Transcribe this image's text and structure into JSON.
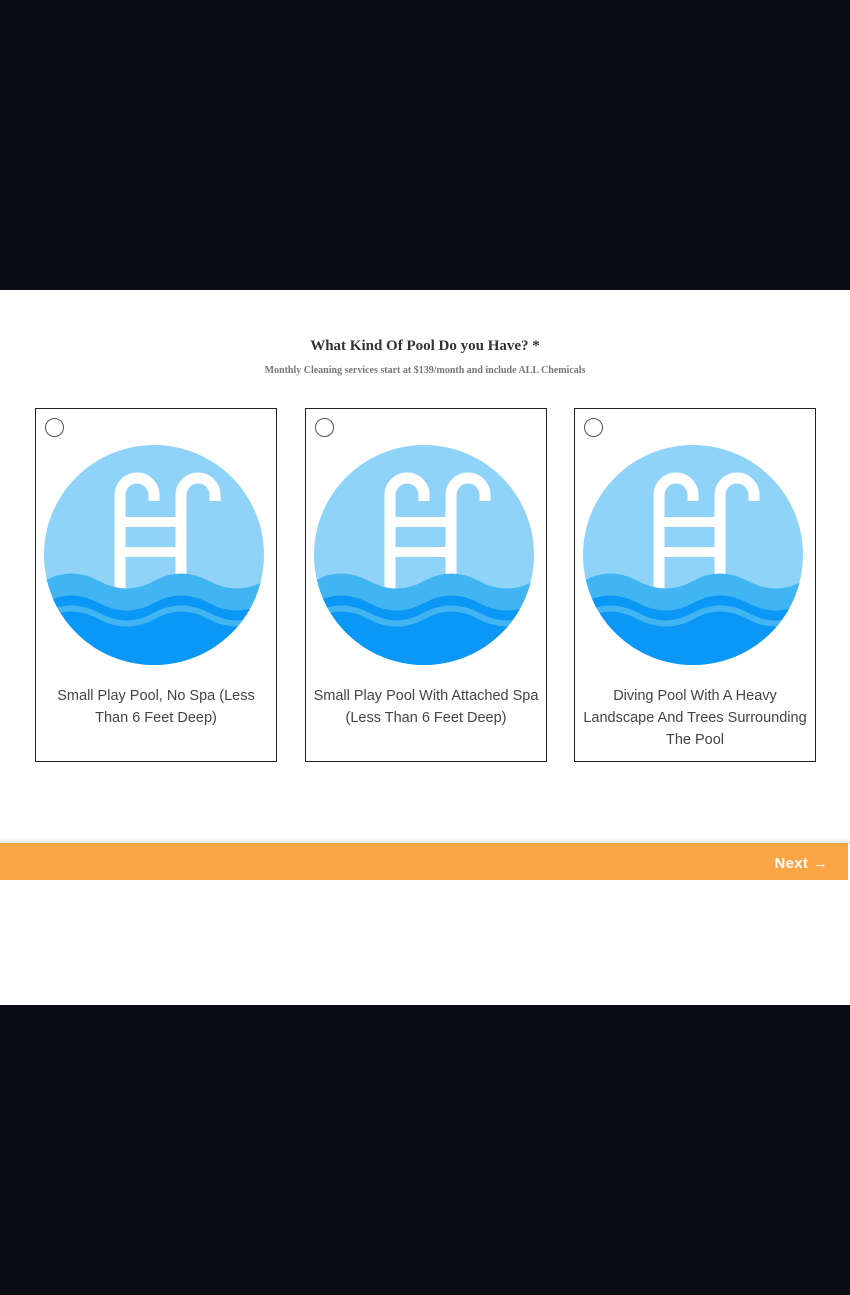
{
  "form": {
    "question": "What Kind Of Pool Do you Have? *",
    "subtitle": "Monthly Cleaning services start at $139/month and include ALL Chemicals"
  },
  "options": [
    {
      "label": "Small Play Pool, No Spa (Less Than 6 Feet Deep)",
      "icon": "pool-ladder-icon",
      "selected": false
    },
    {
      "label": "Small Play Pool With Attached Spa (Less Than 6 Feet Deep)",
      "icon": "pool-ladder-icon",
      "selected": false
    },
    {
      "label": "Diving Pool With A Heavy Landscape And Trees Surrounding The Pool",
      "icon": "pool-ladder-icon",
      "selected": false
    }
  ],
  "footer": {
    "next_label": "Next →"
  },
  "colors": {
    "background": "#0b0c12",
    "panel": "#ffffff",
    "accent": "#fba544",
    "icon_sky": "#8fd4f8",
    "icon_water_light": "#41b5f2",
    "icon_water_dark": "#0a97f5"
  }
}
